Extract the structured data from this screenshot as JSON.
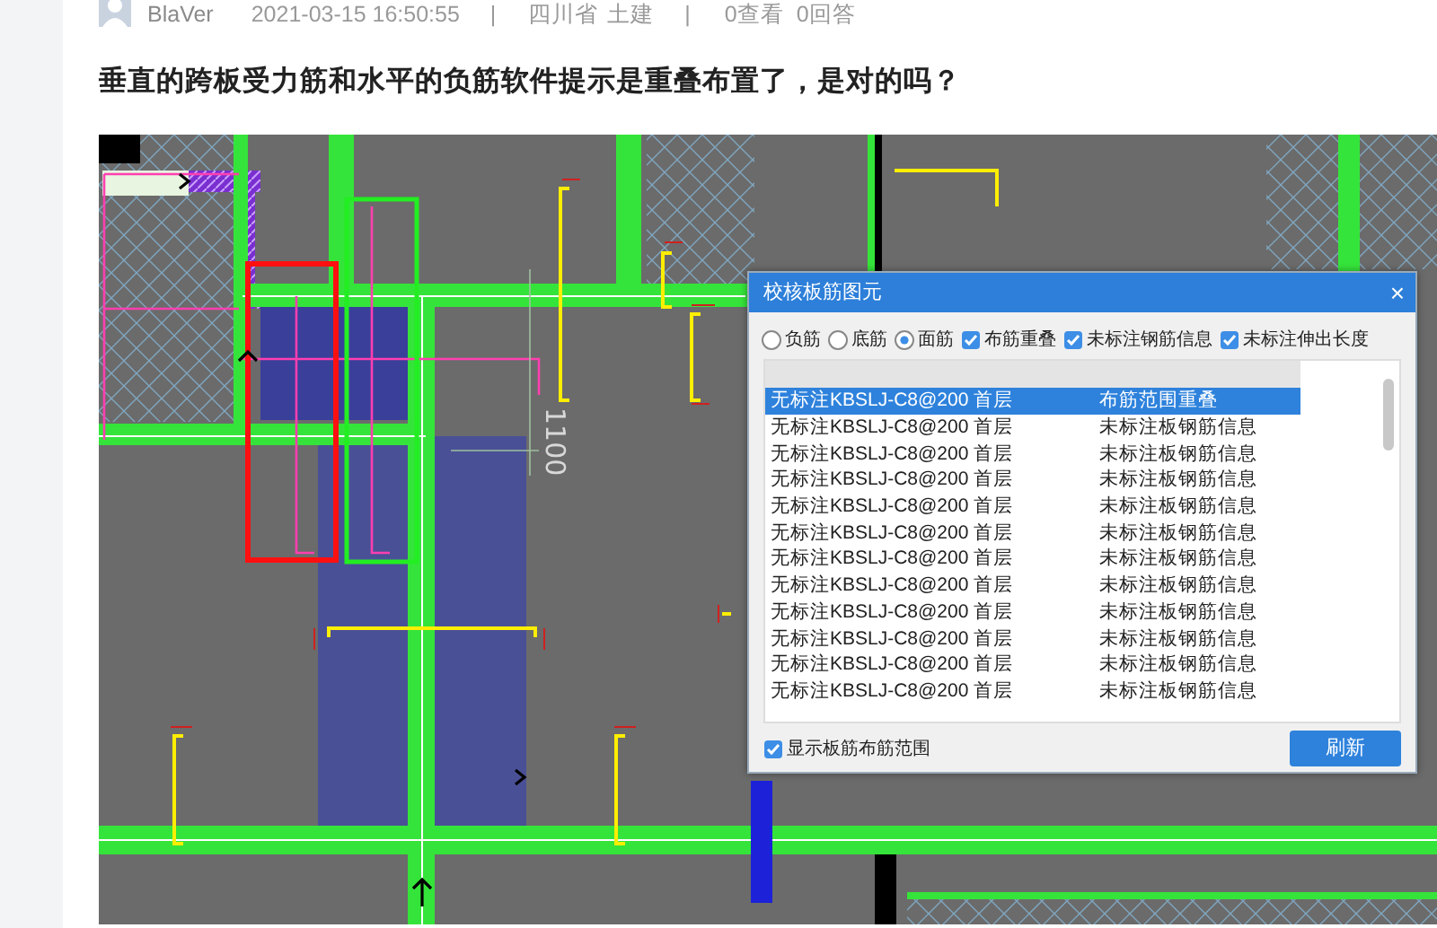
{
  "post": {
    "author": "BlaVer",
    "date": "2021-03-15 16:50:55",
    "separator_1": "|",
    "location": "四川省",
    "category": "土建",
    "separator_2": "|",
    "views": "0查看",
    "answers": "0回答"
  },
  "question_title": "垂直的跨板受力筋和水平的负筋软件提示是重叠布置了，是对的吗？",
  "screenshot": {
    "dimension_label": "1100",
    "dialog": {
      "title": "校核板筋图元",
      "close": "×",
      "filters": [
        {
          "kind": "radio",
          "label": "负筋",
          "selected": false
        },
        {
          "kind": "radio",
          "label": "底筋",
          "selected": false
        },
        {
          "kind": "radio",
          "label": "面筋",
          "selected": true
        },
        {
          "kind": "checkbox",
          "label": "布筋重叠",
          "checked": true
        },
        {
          "kind": "checkbox",
          "label": "未标注钢筋信息",
          "checked": true
        },
        {
          "kind": "checkbox",
          "label": "未标注伸出长度",
          "checked": true
        }
      ],
      "rows": [
        {
          "name": "无标注KBSLJ-C8@200",
          "floor": "首层",
          "issue": "布筋范围重叠",
          "selected": true
        },
        {
          "name": "无标注KBSLJ-C8@200",
          "floor": "首层",
          "issue": "未标注板钢筋信息",
          "selected": false
        },
        {
          "name": "无标注KBSLJ-C8@200",
          "floor": "首层",
          "issue": "未标注板钢筋信息",
          "selected": false
        },
        {
          "name": "无标注KBSLJ-C8@200",
          "floor": "首层",
          "issue": "未标注板钢筋信息",
          "selected": false
        },
        {
          "name": "无标注KBSLJ-C8@200",
          "floor": "首层",
          "issue": "未标注板钢筋信息",
          "selected": false
        },
        {
          "name": "无标注KBSLJ-C8@200",
          "floor": "首层",
          "issue": "未标注板钢筋信息",
          "selected": false
        },
        {
          "name": "无标注KBSLJ-C8@200",
          "floor": "首层",
          "issue": "未标注板钢筋信息",
          "selected": false
        },
        {
          "name": "无标注KBSLJ-C8@200",
          "floor": "首层",
          "issue": "未标注板钢筋信息",
          "selected": false
        },
        {
          "name": "无标注KBSLJ-C8@200",
          "floor": "首层",
          "issue": "未标注板钢筋信息",
          "selected": false
        },
        {
          "name": "无标注KBSLJ-C8@200",
          "floor": "首层",
          "issue": "未标注板钢筋信息",
          "selected": false
        },
        {
          "name": "无标注KBSLJ-C8@200",
          "floor": "首层",
          "issue": "未标注板钢筋信息",
          "selected": false
        },
        {
          "name": "无标注KBSLJ-C8@200",
          "floor": "首层",
          "issue": "未标注板钢筋信息",
          "selected": false
        }
      ],
      "show_range": {
        "label": "显示板筋布筋范围",
        "checked": true
      },
      "refresh_button": "刷新"
    }
  }
}
